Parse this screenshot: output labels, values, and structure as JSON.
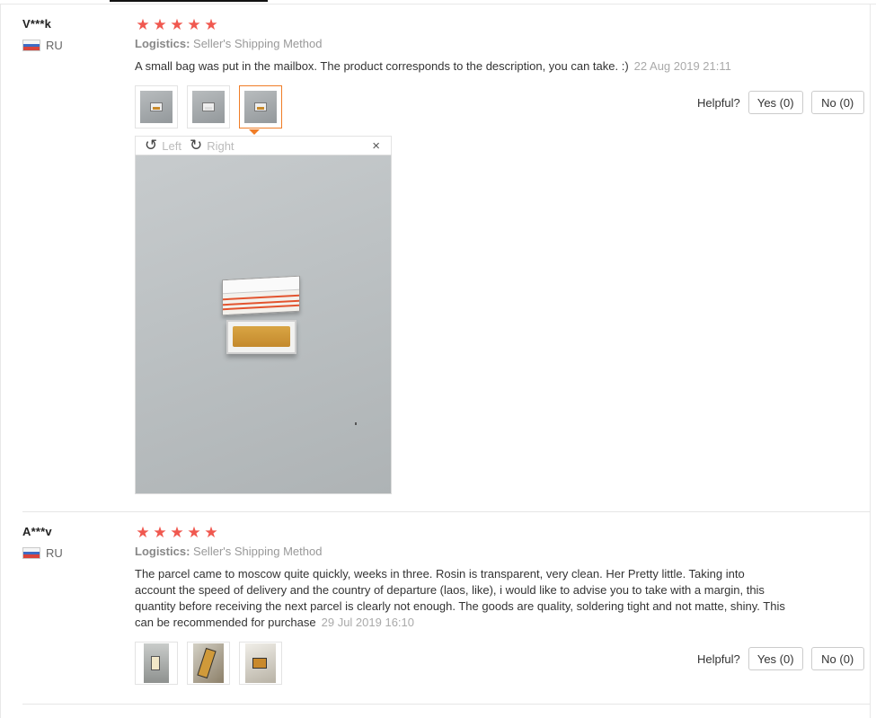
{
  "reviews": [
    {
      "user": "V***k",
      "country": "RU",
      "stars": [
        "★",
        "★",
        "★",
        "★",
        "★"
      ],
      "logistics_label": "Logistics:",
      "logistics_value": "Seller's Shipping Method",
      "text": "A small bag was put in the mailbox. The product corresponds to the description, you can take. :)",
      "date": "22 Aug 2019 21:11",
      "helpful_label": "Helpful?",
      "yes_label": "Yes (0)",
      "no_label": "No (0)",
      "viewer": {
        "rotate_left_label": "Left",
        "rotate_right_label": "Right",
        "close_icon": "×"
      }
    },
    {
      "user": "A***v",
      "country": "RU",
      "stars": [
        "★",
        "★",
        "★",
        "★",
        "★"
      ],
      "logistics_label": "Logistics:",
      "logistics_value": "Seller's Shipping Method",
      "text": "The parcel came to moscow quite quickly, weeks in three. Rosin is transparent, very clean. Her Pretty little. Taking into account the speed of delivery and the country of departure (laos, like), i would like to advise you to take with a margin, this quantity before receiving the next parcel is clearly not enough. The goods are quality, soldering tight and not matte, shiny. This can be recommended for purchase",
      "date": "29 Jul 2019 16:10",
      "helpful_label": "Helpful?",
      "yes_label": "Yes (0)",
      "no_label": "No (0)"
    }
  ],
  "icons": {
    "star": "star-icon",
    "rotate_left": "rotate-left-icon",
    "rotate_right": "rotate-right-icon",
    "close": "close-icon"
  },
  "colors": {
    "star": "#f0584f",
    "active_thumb_border": "#f07d27",
    "muted_text": "#999999"
  }
}
